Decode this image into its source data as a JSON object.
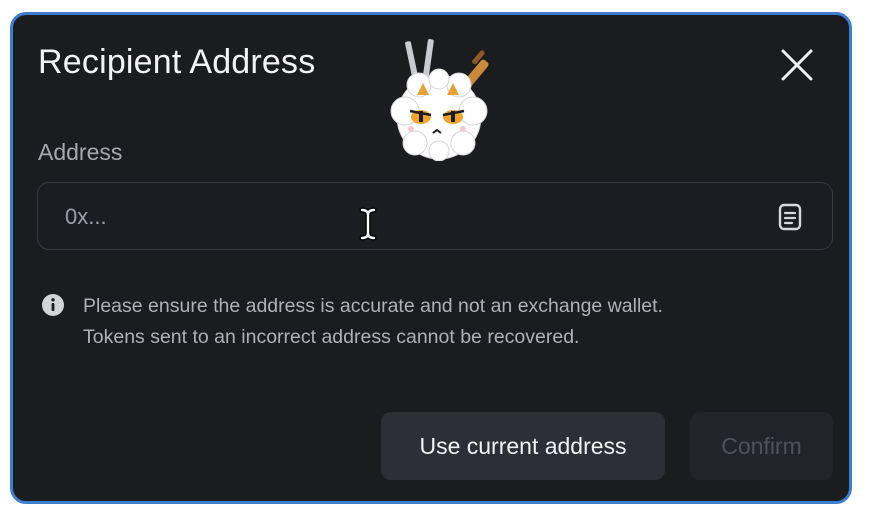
{
  "dialog": {
    "title": "Recipient Address",
    "close_icon": "close-icon"
  },
  "address_field": {
    "label": "Address",
    "placeholder": "0x...",
    "value": "",
    "paste_icon": "clipboard-paste-icon"
  },
  "notice": {
    "icon": "info-icon",
    "line1": "Please ensure the address is accurate and not an exchange wallet.",
    "line2": "Tokens sent to an incorrect address cannot be recovered."
  },
  "actions": {
    "use_current_label": "Use current address",
    "confirm_label": "Confirm",
    "confirm_disabled": true
  },
  "colors": {
    "background": "#1b1c20",
    "frame_border": "#3d7fcf",
    "secondary_button": "#2d2f37",
    "disabled_button": "#23242a"
  }
}
